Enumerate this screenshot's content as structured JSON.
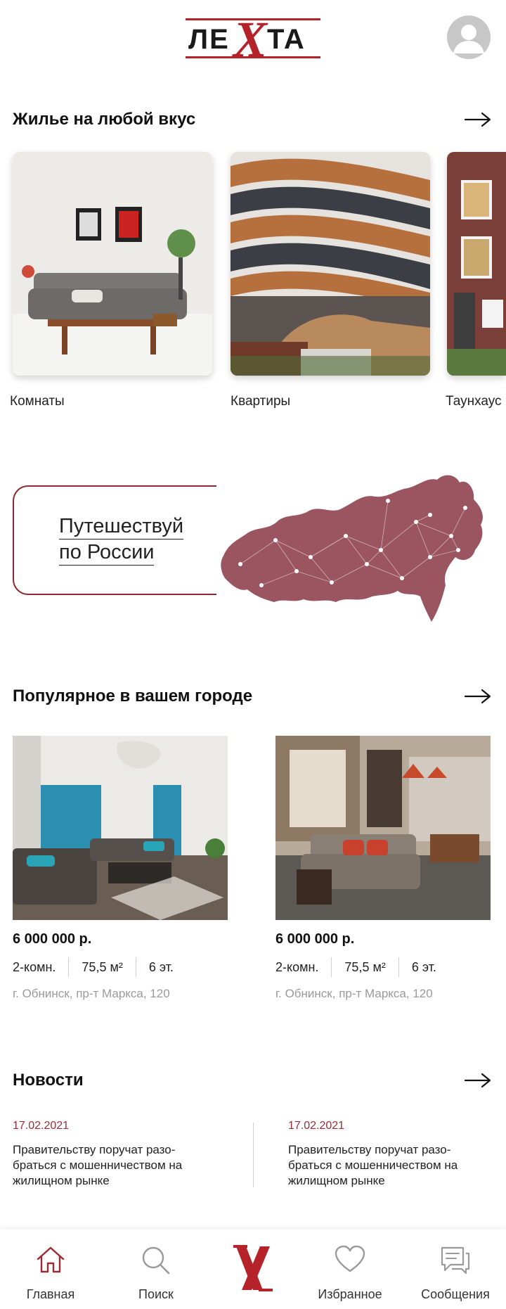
{
  "header": {
    "logo_text": "ЛЕХТА",
    "logo_left": "ЛЕ",
    "logo_x": "Х",
    "logo_right": "ТА"
  },
  "sections": {
    "housing": {
      "title": "Жилье на любой вкус"
    },
    "popular": {
      "title": "Популярное в вашем городе"
    },
    "news": {
      "title": "Новости"
    }
  },
  "categories": [
    {
      "label": "Комнаты"
    },
    {
      "label": "Квартиры"
    },
    {
      "label": "Таунхаус"
    }
  ],
  "banner": {
    "line1": "Путешествуй",
    "line2": "по России"
  },
  "listings": [
    {
      "price": "6 000 000 р.",
      "rooms": "2-комн.",
      "area": "75,5 м²",
      "floor": "6 эт.",
      "address": "г. Обнинск, пр-т Маркса, 120"
    },
    {
      "price": "6 000 000 р.",
      "rooms": "2-комн.",
      "area": "75,5 м²",
      "floor": "6 эт.",
      "address": "г. Обнинск, пр-т Маркса, 120"
    }
  ],
  "news": [
    {
      "date": "17.02.2021",
      "text": "Правительству поручат разо-\nбраться с мошенничеством на\nжилищном рынке"
    },
    {
      "date": "17.02.2021",
      "text": "Правительству поручат разо-\nбраться с мошенничеством на\nжилищном рынке"
    }
  ],
  "tabbar": {
    "items": [
      {
        "label": "Главная",
        "icon": "home-icon"
      },
      {
        "label": "Поиск",
        "icon": "search-icon"
      },
      {
        "label": "",
        "icon": "lexta-logo-icon"
      },
      {
        "label": "Избранное",
        "icon": "heart-icon"
      },
      {
        "label": "Сообщения",
        "icon": "messages-icon"
      }
    ]
  },
  "colors": {
    "brand_red": "#b5222a",
    "banner_border": "#8e2a33",
    "map_fill": "#9a5560",
    "news_date": "#9b2b35"
  }
}
